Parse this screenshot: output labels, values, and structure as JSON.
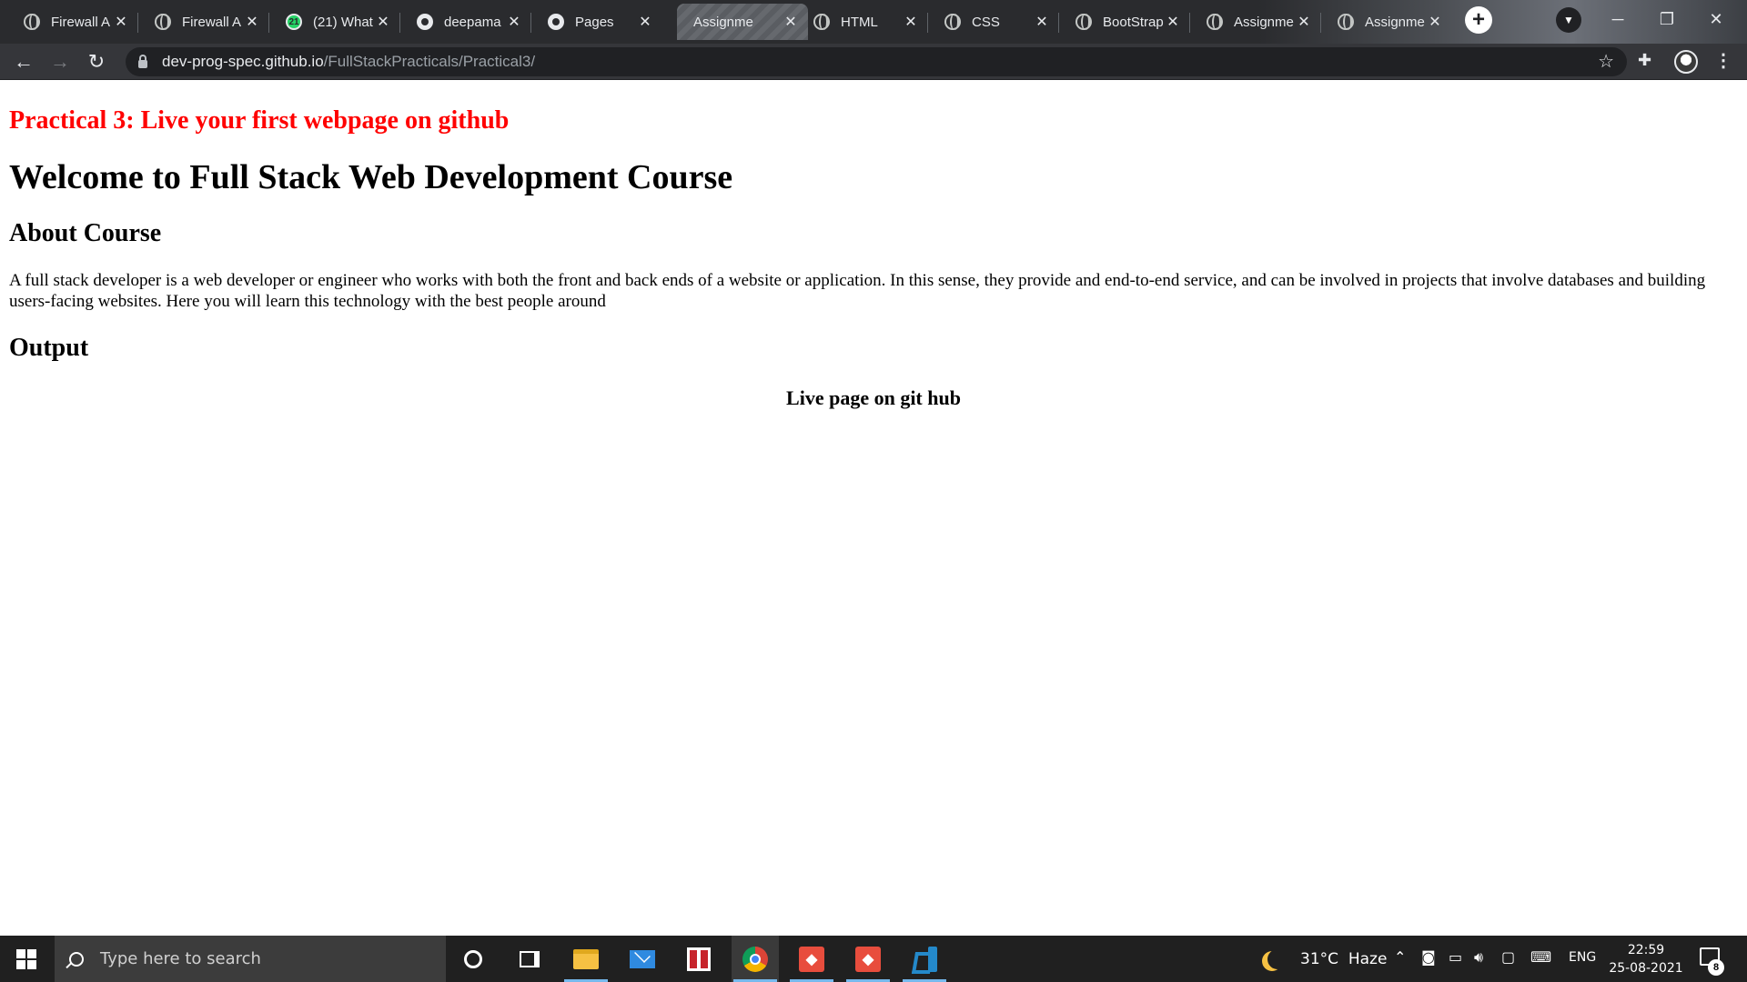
{
  "browser": {
    "tabs": [
      {
        "title": "Firewall A",
        "icon": "globe-icon"
      },
      {
        "title": "Firewall A",
        "icon": "globe-icon"
      },
      {
        "title": "(21) What",
        "icon": "whatsapp-icon",
        "badge": "21"
      },
      {
        "title": "deepama",
        "icon": "github-icon"
      },
      {
        "title": "Pages",
        "icon": "github-icon"
      },
      {
        "title": "Assignme",
        "icon": "none",
        "active": true
      },
      {
        "title": "HTML",
        "icon": "globe-icon"
      },
      {
        "title": "CSS",
        "icon": "globe-icon"
      },
      {
        "title": "BootStrap",
        "icon": "globe-icon"
      },
      {
        "title": "Assignme",
        "icon": "globe-icon"
      },
      {
        "title": "Assignme",
        "icon": "globe-icon"
      }
    ],
    "close_glyph": "✕",
    "new_tab_glyph": "+",
    "url_host": "dev-prog-spec.github.io",
    "url_path": "/FullStackPracticals/Practical3/"
  },
  "page": {
    "practical_title": "Practical 3: Live your first webpage on github",
    "course_title": "Welcome to Full Stack Web Development Course",
    "about_heading": "About Course",
    "about_text": "A full stack developer is a web developer or engineer who works with both the front and back ends of a website or application. In this sense, they provide and end-to-end service, and can be involved in projects that involve databases and building users-facing websites. Here you will learn this technology with the best people around",
    "output_heading": "Output",
    "live_text": "Live page on git hub",
    "title_color": "#ff0000"
  },
  "taskbar": {
    "search_placeholder": "Type here to search",
    "weather_temp": "31°C",
    "weather_desc": "Haze",
    "language": "ENG",
    "time": "22:59",
    "date": "25-08-2021",
    "notification_count": "8"
  }
}
